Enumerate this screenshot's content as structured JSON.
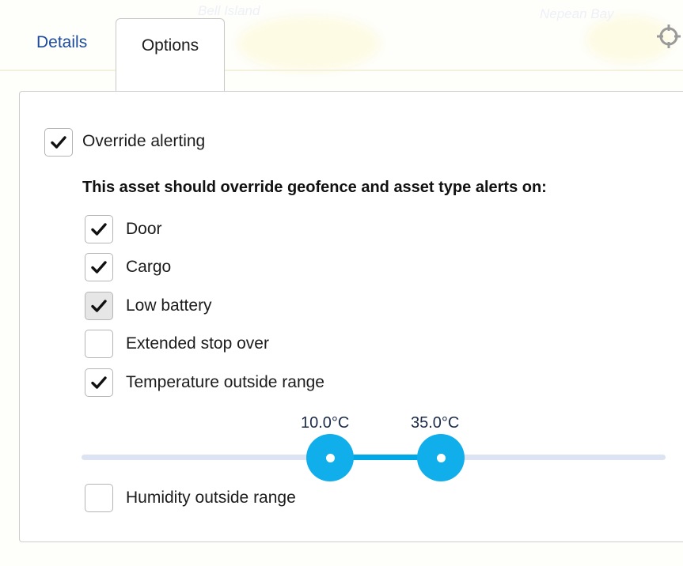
{
  "map": {
    "labels": [
      "Bell Island",
      "Nepean Bay"
    ]
  },
  "tabs": {
    "details": "Details",
    "options": "Options"
  },
  "options": {
    "override": {
      "label": "Override alerting",
      "checked": true
    },
    "section_title": "This asset should override geofence and asset type alerts on:",
    "alerts": [
      {
        "label": "Door",
        "checked": true
      },
      {
        "label": "Cargo",
        "checked": true
      },
      {
        "label": "Low battery",
        "checked": true
      },
      {
        "label": "Extended stop over",
        "checked": false
      },
      {
        "label": "Temperature outside range",
        "checked": true
      },
      {
        "label": "Humidity outside range",
        "checked": false
      }
    ],
    "temperature_range": {
      "min_label": "10.0°C",
      "max_label": "35.0°C",
      "min": 10.0,
      "max": 35.0
    }
  },
  "colors": {
    "accent": "#00a8e8",
    "link": "#1d4a9a",
    "track": "#dce3f3"
  },
  "icons": {
    "locate": "crosshair-locate-icon",
    "check": "checkmark-icon"
  }
}
